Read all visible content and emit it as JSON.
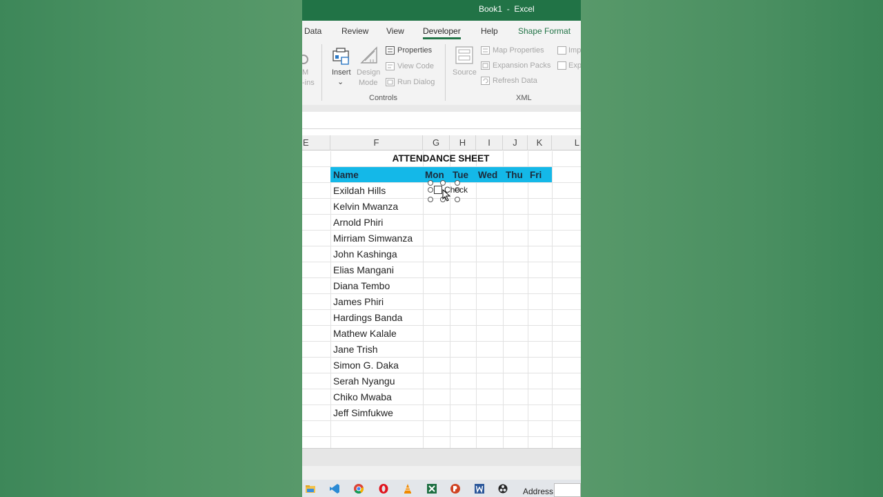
{
  "window": {
    "title": "Book1  -  Excel"
  },
  "ribbon_tabs": [
    "Data",
    "Review",
    "View",
    "Developer",
    "Help",
    "Shape Format"
  ],
  "ribbon": {
    "addins_partial_top": "M",
    "addins_partial_bottom": "-ins",
    "insert": "Insert",
    "insert_caret": "⌄",
    "design_line1": "Design",
    "design_line2": "Mode",
    "properties": "Properties",
    "view_code": "View Code",
    "run_dialog": "Run Dialog",
    "controls_group": "Controls",
    "source": "Source",
    "map_properties": "Map Properties",
    "expansion_packs": "Expansion Packs",
    "refresh_data": "Refresh Data",
    "import_partial": "Imp",
    "export_partial": "Exp",
    "xml_group": "XML"
  },
  "columns": [
    "E",
    "F",
    "G",
    "H",
    "I",
    "J",
    "K",
    "L"
  ],
  "sheet": {
    "title": "ATTENDANCE SHEET",
    "headers": [
      "Name",
      "Mon",
      "Tue",
      "Wed",
      "Thu",
      "Fri"
    ],
    "names": [
      "Exildah Hills",
      "Kelvin Mwanza",
      "Arnold Phiri",
      "Mirriam Simwanza",
      "John Kashinga",
      "Elias Mangani",
      "Diana Tembo",
      "James Phiri",
      "Hardings Banda",
      "Mathew Kalale",
      "Jane Trish",
      "Simon G. Daka",
      "Serah Nyangu",
      "Chiko Mwaba",
      "Jeff Simfukwe"
    ],
    "checkbox_label": "Check"
  },
  "taskbar": {
    "icons": [
      "file-explorer-icon",
      "vscode-icon",
      "chrome-icon",
      "opera-icon",
      "vlc-icon",
      "excel-icon",
      "powerpoint-icon",
      "word-icon",
      "obs-icon"
    ],
    "address_label": "Address"
  },
  "colors": {
    "excel_green": "#217346",
    "header_fill": "#14b8e8"
  }
}
